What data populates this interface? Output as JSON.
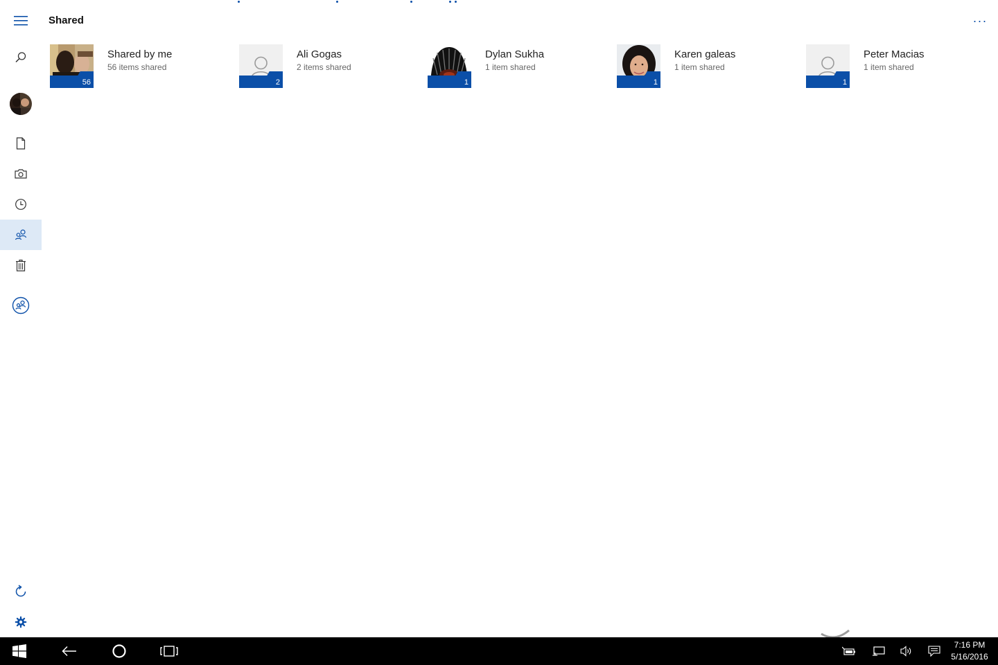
{
  "page": {
    "title": "Shared"
  },
  "colors": {
    "accent": "#0b4fa8",
    "selected_nav": "#dde9f6",
    "taskbar": "#000000"
  },
  "sidebar": {
    "items": [
      {
        "icon": "hamburger-menu-icon"
      },
      {
        "icon": "search-icon"
      },
      {
        "icon": "avatar"
      },
      {
        "icon": "file-icon"
      },
      {
        "icon": "camera-icon"
      },
      {
        "icon": "clock-icon"
      },
      {
        "icon": "people-icon",
        "selected": true
      },
      {
        "icon": "trash-icon"
      },
      {
        "icon": "shared-circle-icon"
      },
      {
        "icon": "refresh-icon"
      },
      {
        "icon": "gear-icon"
      }
    ]
  },
  "header": {
    "more": "···"
  },
  "tiles": [
    {
      "name": "Shared by me",
      "subtitle": "56 items shared",
      "count": "56"
    },
    {
      "name": "Ali Gogas",
      "subtitle": "2 items shared",
      "count": "2"
    },
    {
      "name": "Dylan Sukha",
      "subtitle": "1 item shared",
      "count": "1"
    },
    {
      "name": "Karen galeas",
      "subtitle": "1 item shared",
      "count": "1"
    },
    {
      "name": "Peter Macias",
      "subtitle": "1 item shared",
      "count": "1"
    }
  ],
  "taskbar": {
    "buttons": [
      "windows-start-icon",
      "back-arrow-icon",
      "cortana-circle-icon",
      "task-view-icon"
    ],
    "tray_icons": [
      "battery-icon",
      "network-icon",
      "volume-icon",
      "action-center-icon"
    ],
    "time": "7:16 PM",
    "date": "5/16/2016"
  }
}
